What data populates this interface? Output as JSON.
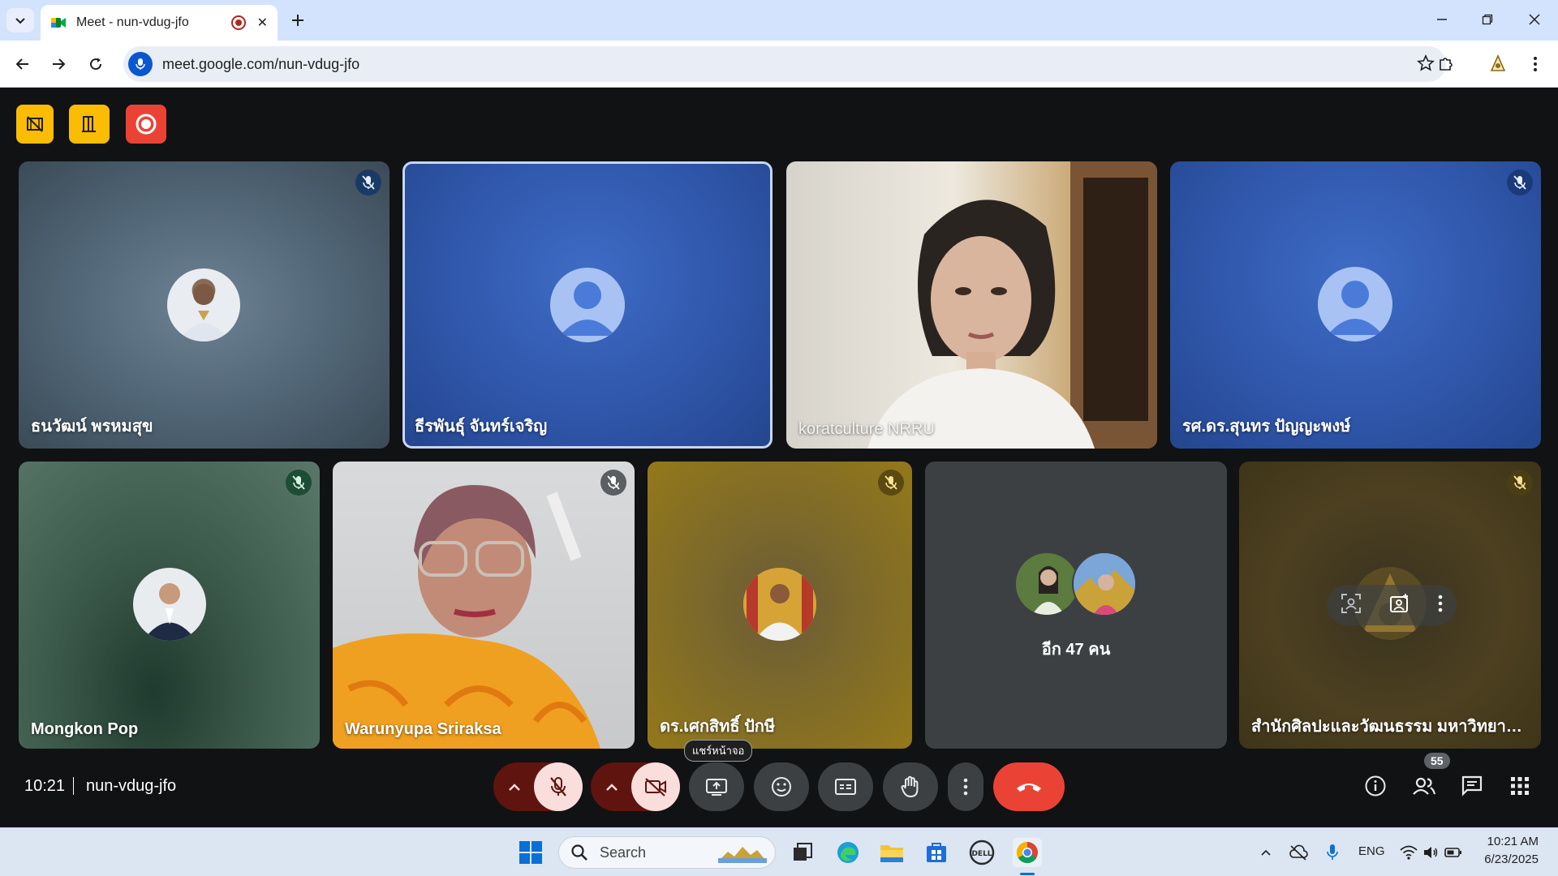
{
  "browser": {
    "tab_title": "Meet - nun-vdug-jfo",
    "url": "meet.google.com/nun-vdug-jfo"
  },
  "meet": {
    "tiles": [
      {
        "name": "ธนวัฒน์ พรหมสุข",
        "muted": true
      },
      {
        "name": "ธีรพันธุ์ จันทร์เจริญ",
        "muted": false,
        "active": true
      },
      {
        "name": "koratculture NRRU",
        "muted": false
      },
      {
        "name": "รศ.ดร.สุนทร ปัญญะพงษ์",
        "muted": true
      },
      {
        "name": "Mongkon Pop",
        "muted": true
      },
      {
        "name": "Warunyupa Sriraksa",
        "muted": true
      },
      {
        "name": "ดร.เศกสิทธิ์ ปักษี",
        "muted": true
      },
      {
        "name": "",
        "muted": false
      },
      {
        "name": "สำนักศิลปะและวัฒนธรรม มหาวิทยาลัย...",
        "muted": true
      }
    ],
    "others_label": "อีก 47 คน",
    "time": "10:21",
    "meeting_code": "nun-vdug-jfo",
    "present_tooltip": "แชร์หน้าจอ",
    "participant_count": "55",
    "colors": {
      "end_call": "#ea4335",
      "muted_btn": "#f9dedc",
      "muted_chevron": "#601410",
      "host_yellow": "#fbbc04",
      "host_red": "#ea4335"
    }
  },
  "taskbar": {
    "search_label": "Search",
    "language": "ENG",
    "time": "10:21 AM",
    "date": "6/23/2025"
  }
}
